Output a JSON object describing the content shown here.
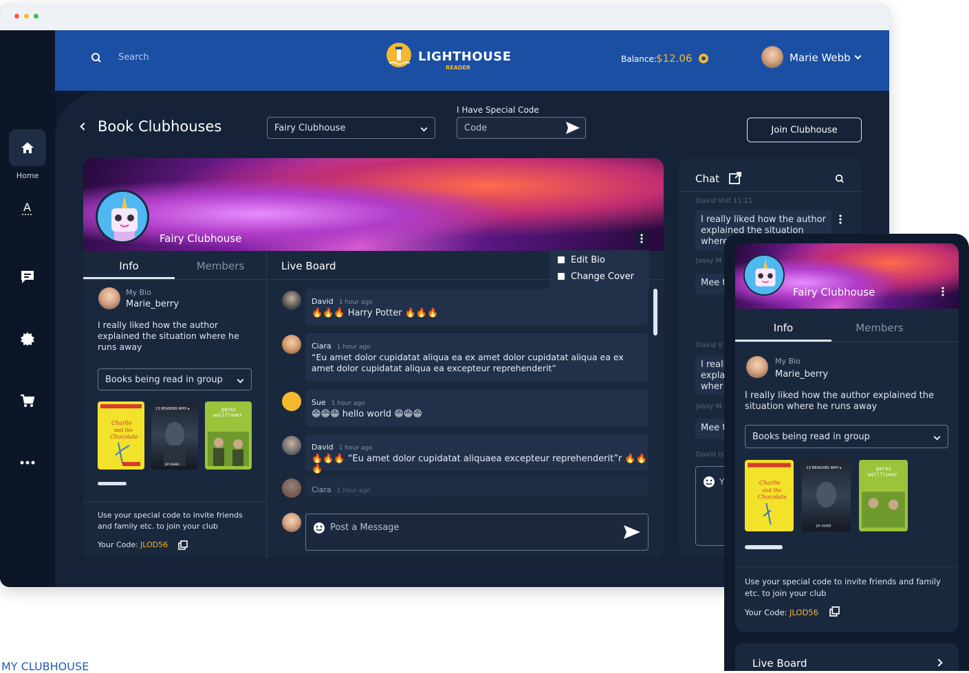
{
  "header": {
    "search_placeholder": "Search",
    "logo_title": "LIGHTHOUSE",
    "logo_subtitle": "READER",
    "balance_label": "Balance:",
    "balance_value": "$12.06",
    "user_name": "Marie Webb"
  },
  "sidebar": {
    "home_label": "Home"
  },
  "page": {
    "title": "Book Clubhouses",
    "clubhouse_select": "Fairy Clubhouse",
    "special_code_label": "I Have Special Code",
    "code_placeholder": "Code",
    "join_button": "Join Clubhouse"
  },
  "club": {
    "name": "Fairy Clubhouse",
    "menu": [
      "Edit Bio",
      "Change Cover"
    ],
    "tabs": [
      "Info",
      "Members"
    ],
    "bio_label": "My Bio",
    "bio_user": "Marie_berry",
    "bio_text": "I really liked how the author explained the situation where he runs away",
    "books_select": "Books being read in group",
    "invite_text": "Use your special code to invite friends and family etc. to join your club",
    "code_label": "Your Code:",
    "code_value": "JLOD56"
  },
  "board": {
    "title": "Live Board",
    "messages": [
      {
        "name": "David",
        "time": "1 hour ago",
        "text": "🔥🔥🔥 Harry Potter 🔥🔥🔥"
      },
      {
        "name": "Ciara",
        "time": "1 hour ago",
        "text": "“Eu amet dolor cupidatat aliqua ea ex amet dolor cupidatat aliqua ea ex amet dolor cupidatat aliqua ea excepteur reprehenderit”"
      },
      {
        "name": "Sue",
        "time": "1 hour ago",
        "text": "😁😁😁 hello world 😁😁😁"
      },
      {
        "name": "David",
        "time": "1 hour ago",
        "text": "🔥🔥🔥 “Eu amet dolor cupidatat aliquaea excepteur reprehenderit”r 🔥🔥🔥"
      },
      {
        "name": "Ciara",
        "time": "1 hour ago",
        "text": ""
      }
    ],
    "post_placeholder": "Post a Message"
  },
  "chat": {
    "title": "Chat",
    "items": [
      {
        "meta": "David Volf  11:21",
        "text": "I really liked how the author explained the situation where"
      },
      {
        "meta": "Jassy M",
        "text": "Mee t"
      },
      {
        "meta": "David V",
        "text": "I reall expla wher"
      },
      {
        "meta": "Jassy M",
        "text": "Mee t"
      },
      {
        "meta": "David is",
        "text": ""
      }
    ],
    "input_letter": "Y"
  },
  "mobile": {
    "club_name": "Fairy Clubhouse",
    "tabs": [
      "Info",
      "Members"
    ],
    "bio_label": "My Bio",
    "bio_user": "Marie_berry",
    "bio_text": "I really liked how the author explained the situation where he runs away",
    "books_select": "Books being read in group",
    "invite_text": "Use your special code to invite friends and family etc. to join your club",
    "code_label": "Your Code:",
    "code_value": "JLOD56",
    "live_board": "Live Board"
  },
  "books": [
    "Charlie and the Chocolate Factory",
    "13 REASONS WHY",
    "the perks of being a wallflower"
  ],
  "caption": "MY CLUBHOUSE",
  "colors": {
    "accent": "#f5b82e",
    "topbar": "#1a4fa3",
    "background": "#152238"
  }
}
